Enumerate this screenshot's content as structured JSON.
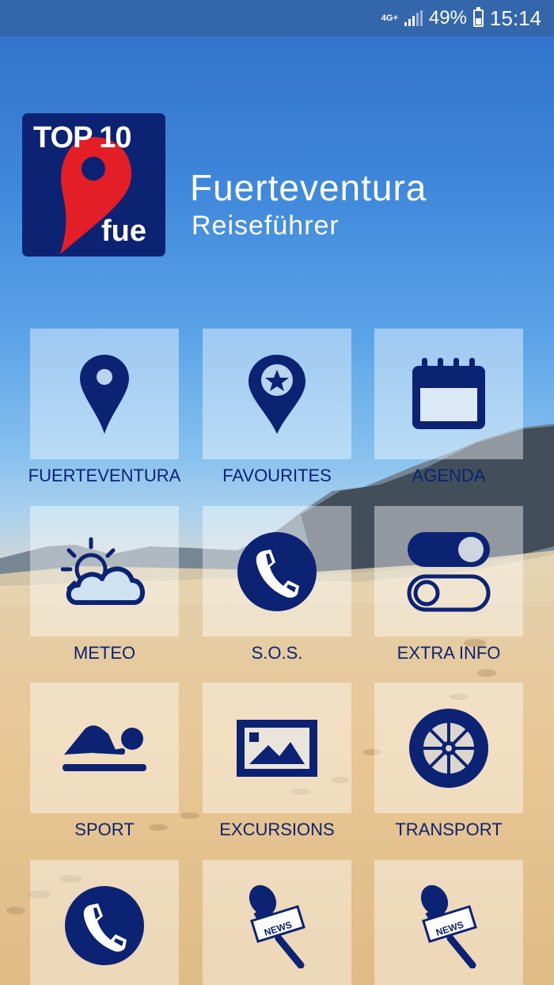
{
  "status_bar": {
    "network": "4G+",
    "battery": "49%",
    "time": "15:14"
  },
  "logo": {
    "top_text": "TOP 10",
    "bottom_text": "fue"
  },
  "header": {
    "title": "Fuerteventura",
    "subtitle": "Reiseführer"
  },
  "menu": [
    {
      "label": "FUERTEVENTURA",
      "icon": "map-pin-icon"
    },
    {
      "label": "FAVOURITES",
      "icon": "star-pin-icon"
    },
    {
      "label": "AGENDA",
      "icon": "calendar-icon"
    },
    {
      "label": "METEO",
      "icon": "weather-icon"
    },
    {
      "label": "S.O.S.",
      "icon": "phone-icon"
    },
    {
      "label": "EXTRA INFO",
      "icon": "toggles-icon"
    },
    {
      "label": "SPORT",
      "icon": "swimmer-icon"
    },
    {
      "label": "EXCURSIONS",
      "icon": "picture-icon"
    },
    {
      "label": "TRANSPORT",
      "icon": "wheel-icon"
    },
    {
      "label": "",
      "icon": "phone-icon"
    },
    {
      "label": "",
      "icon": "news-microphone-icon"
    },
    {
      "label": "",
      "icon": "news-microphone-icon"
    }
  ],
  "colors": {
    "status_bar": "#3466ab",
    "logo_bg": "#0c2272",
    "logo_pin": "#e41e26",
    "icon": "#0c2272"
  }
}
